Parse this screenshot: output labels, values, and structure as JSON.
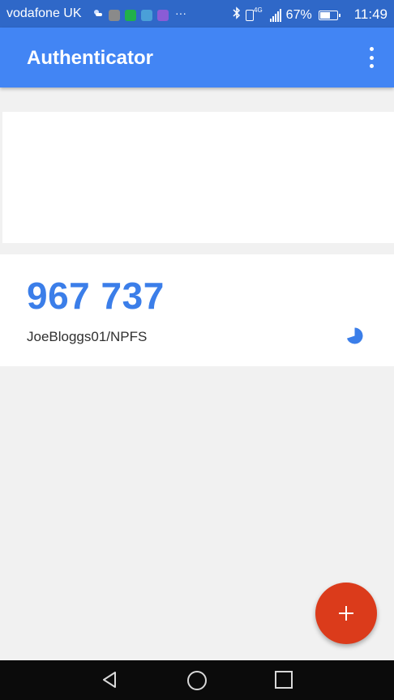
{
  "status_bar": {
    "carrier": "vodafone UK",
    "more_notifications": "···",
    "network_type": "4G",
    "battery_percent": "67%",
    "battery_level": 0.67,
    "time": "11:49",
    "notification_icons": [
      "weather-icon",
      "photo-icon",
      "whatsapp-icon",
      "gallery-icon",
      "messenger-icon"
    ],
    "system_icons": [
      "bluetooth-icon",
      "vibrate-icon",
      "signal-icon",
      "battery-icon"
    ]
  },
  "app_bar": {
    "title": "Authenticator",
    "menu_icon": "more-vert-icon"
  },
  "accounts": [
    {
      "code": "967 737",
      "name": "JoeBloggs01/NPFS",
      "timer_remaining": 0.7
    }
  ],
  "fab": {
    "icon": "add-icon"
  },
  "nav_bar": {
    "buttons": [
      "back-icon",
      "home-icon",
      "recents-icon"
    ]
  },
  "colors": {
    "status_bar": "#2f68c8",
    "app_bar": "#4285f4",
    "code_text": "#3b7ee9",
    "fab": "#db3b1b",
    "background": "#f1f1f1",
    "nav_bar": "#0b0b0b"
  }
}
